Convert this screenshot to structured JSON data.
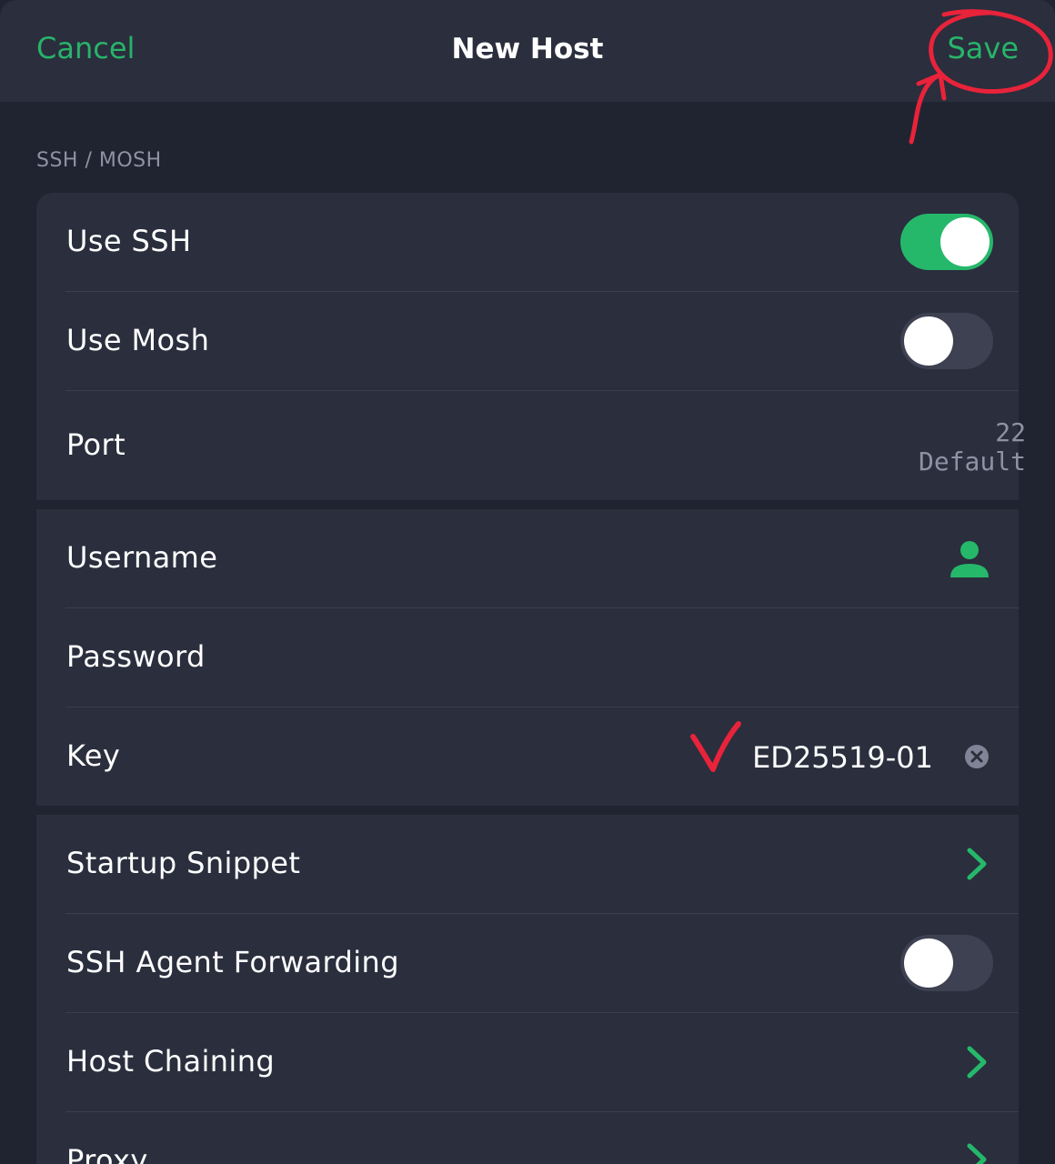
{
  "nav": {
    "cancel_label": "Cancel",
    "title": "New Host",
    "save_label": "Save"
  },
  "section": {
    "header": "SSH / MOSH"
  },
  "rows": {
    "use_ssh": {
      "label": "Use SSH",
      "enabled": true
    },
    "use_mosh": {
      "label": "Use Mosh",
      "enabled": false
    },
    "port": {
      "label": "Port",
      "value": "22",
      "placeholder": "Default"
    },
    "username": {
      "label": "Username",
      "icon": "person-icon"
    },
    "password": {
      "label": "Password"
    },
    "key": {
      "label": "Key",
      "value": "ED25519-01",
      "clear_icon": "clear-icon"
    },
    "startup_snippet": {
      "label": "Startup Snippet",
      "icon": "chevron-right-icon"
    },
    "agent_forwarding": {
      "label": "SSH Agent Forwarding",
      "enabled": false
    },
    "host_chaining": {
      "label": "Host Chaining",
      "icon": "chevron-right-icon"
    },
    "proxy": {
      "label": "Proxy",
      "icon": "chevron-right-icon"
    }
  },
  "colors": {
    "accent": "#28b36a",
    "background": "#202431",
    "cell": "#2a2e3d",
    "annotation": "#e8233a"
  }
}
